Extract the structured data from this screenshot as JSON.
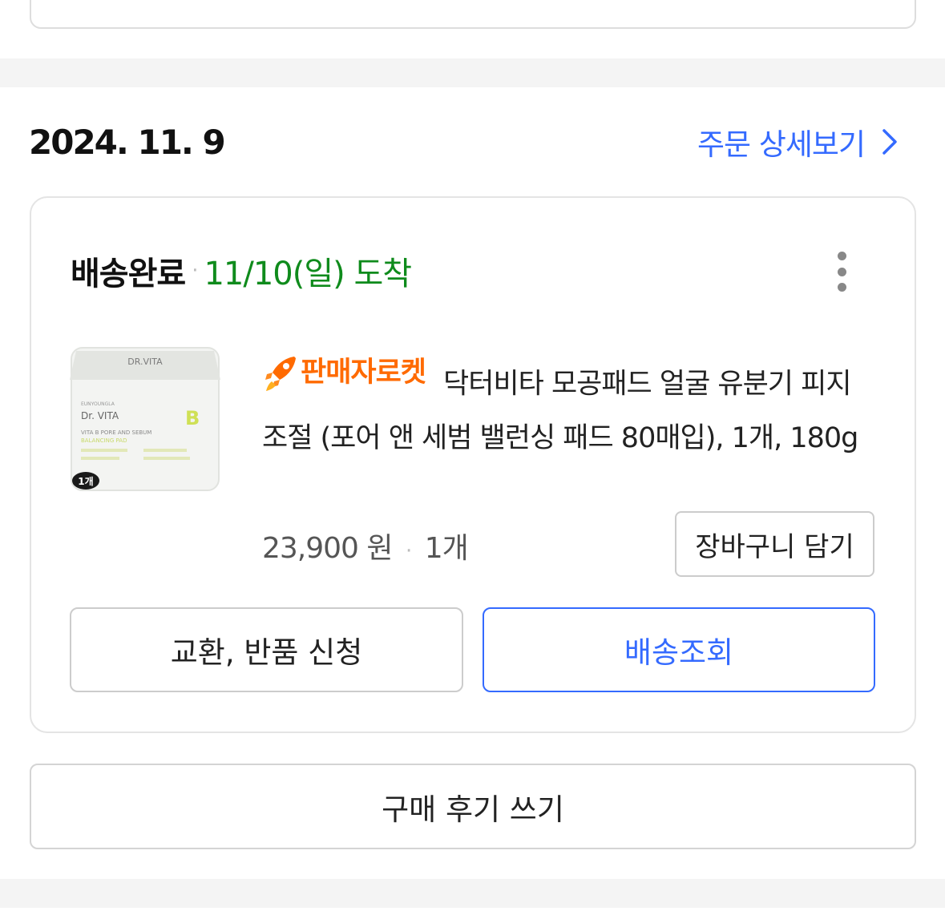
{
  "order": {
    "date": "2024. 11. 9",
    "detail_link_label": "주문 상세보기",
    "status": "배송완료",
    "separator": "·",
    "arrival": "11/10(일) 도착",
    "product": {
      "badge": "판매자로켓",
      "title": "닥터비타 모공패드 얼굴 유분기 피지조절 (포어 앤 세범 밸런싱 패드 80매입), 1개, 180g",
      "price": "23,900 원",
      "quantity": "1개",
      "image": {
        "brand_small": "DR.VITA",
        "maker": "EUNYOUNGLA",
        "brand": "Dr. VITA",
        "line1": "VITA B PORE AND SEBUM",
        "line2": "BALANCING PAD",
        "letter": "B",
        "count_badge": "1개"
      }
    },
    "cart_button": "장바구니 담기",
    "exchange_button": "교환, 반품 신청",
    "track_button": "배송조회",
    "review_button": "구매 후기 쓰기"
  },
  "colors": {
    "accent": "#346aff",
    "arrival_green": "#0f8b1c",
    "badge_orange": "#ff6a00",
    "divider_band": "#f4f4f4"
  },
  "icons": [
    "chevron-right-icon",
    "more-vertical-icon",
    "rocket-icon"
  ]
}
